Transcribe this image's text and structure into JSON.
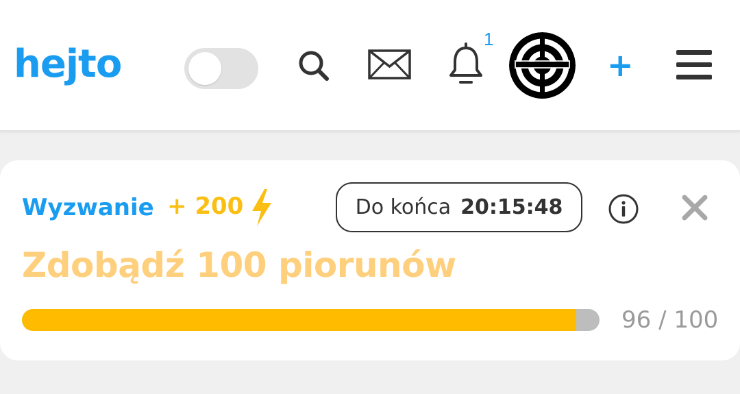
{
  "header": {
    "logo_text": "hejto",
    "theme_toggle": {
      "state": "off"
    },
    "icons": {
      "search": "search-icon",
      "mail": "envelope-icon",
      "notifications": "bell-icon",
      "menu": "hamburger-menu-icon",
      "avatar": "target-avatar"
    },
    "notification_count": "1",
    "add_label": "+"
  },
  "challenge": {
    "label": "Wyzwanie",
    "points": "+ 200",
    "points_icon": "lightning-bolt-icon",
    "timer_label": "Do końca",
    "timer_value": "20:15:48",
    "title": "Zdobądź 100 piorunów",
    "progress_current": 96,
    "progress_total": 100,
    "progress_text": "96 / 100"
  },
  "colors": {
    "brand_blue": "#1a9cf0",
    "accent_yellow": "#febb00",
    "title_yellow": "#fecf7c",
    "track_gray": "#bdbdbd",
    "background": "#f0f0f0"
  }
}
